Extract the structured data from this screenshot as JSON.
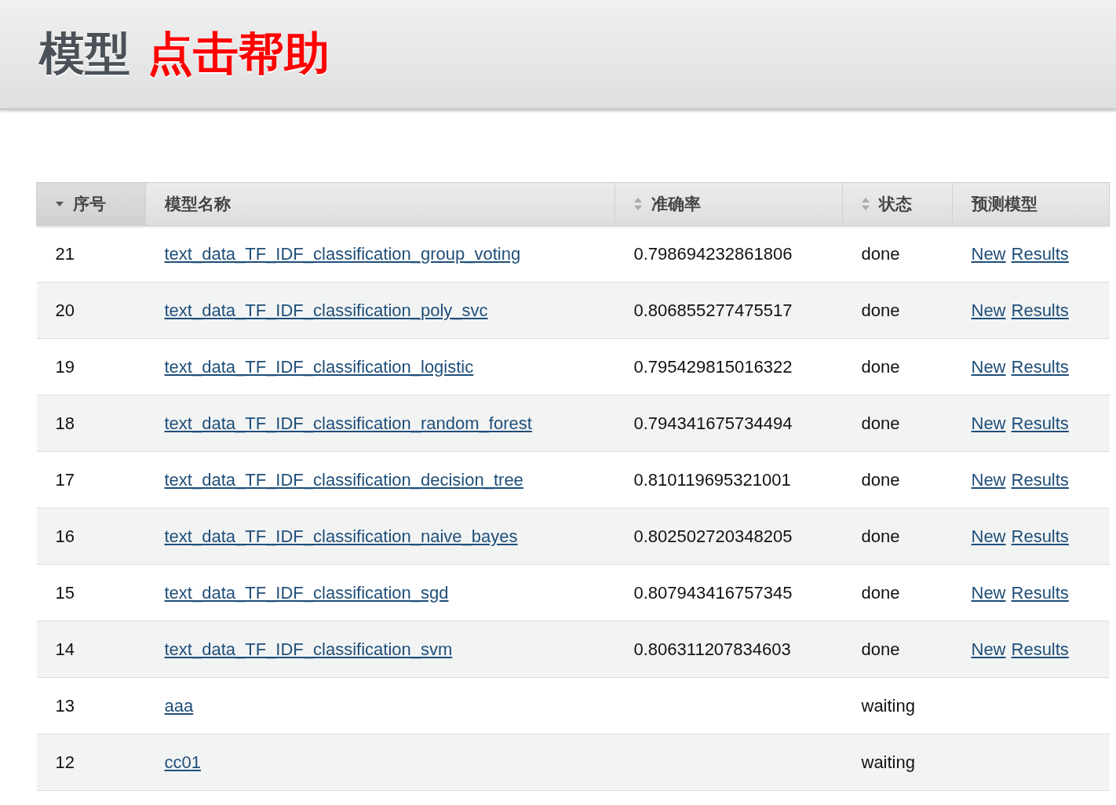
{
  "header": {
    "title": "模型",
    "help_link": "点击帮助"
  },
  "table": {
    "columns": [
      {
        "label": "序号",
        "sorted": true,
        "sortable": true
      },
      {
        "label": "模型名称",
        "sorted": false,
        "sortable": false
      },
      {
        "label": "准确率",
        "sorted": false,
        "sortable": true
      },
      {
        "label": "状态",
        "sorted": false,
        "sortable": true
      },
      {
        "label": "预测模型",
        "sorted": false,
        "sortable": false
      }
    ],
    "rows": [
      {
        "id": "21",
        "name": "text_data_TF_IDF_classification_group_voting",
        "accuracy": "0.798694232861806",
        "status": "done",
        "actions": [
          "New",
          "Results"
        ]
      },
      {
        "id": "20",
        "name": "text_data_TF_IDF_classification_poly_svc",
        "accuracy": "0.806855277475517",
        "status": "done",
        "actions": [
          "New",
          "Results"
        ]
      },
      {
        "id": "19",
        "name": "text_data_TF_IDF_classification_logistic",
        "accuracy": "0.795429815016322",
        "status": "done",
        "actions": [
          "New",
          "Results"
        ]
      },
      {
        "id": "18",
        "name": "text_data_TF_IDF_classification_random_forest",
        "accuracy": "0.794341675734494",
        "status": "done",
        "actions": [
          "New",
          "Results"
        ]
      },
      {
        "id": "17",
        "name": "text_data_TF_IDF_classification_decision_tree",
        "accuracy": "0.810119695321001",
        "status": "done",
        "actions": [
          "New",
          "Results"
        ]
      },
      {
        "id": "16",
        "name": "text_data_TF_IDF_classification_naive_bayes",
        "accuracy": "0.802502720348205",
        "status": "done",
        "actions": [
          "New",
          "Results"
        ]
      },
      {
        "id": "15",
        "name": "text_data_TF_IDF_classification_sgd",
        "accuracy": "0.807943416757345",
        "status": "done",
        "actions": [
          "New",
          "Results"
        ]
      },
      {
        "id": "14",
        "name": "text_data_TF_IDF_classification_svm",
        "accuracy": "0.806311207834603",
        "status": "done",
        "actions": [
          "New",
          "Results"
        ]
      },
      {
        "id": "13",
        "name": "aaa",
        "status": "waiting"
      },
      {
        "id": "12",
        "name": "cc01",
        "status": "waiting"
      }
    ]
  }
}
